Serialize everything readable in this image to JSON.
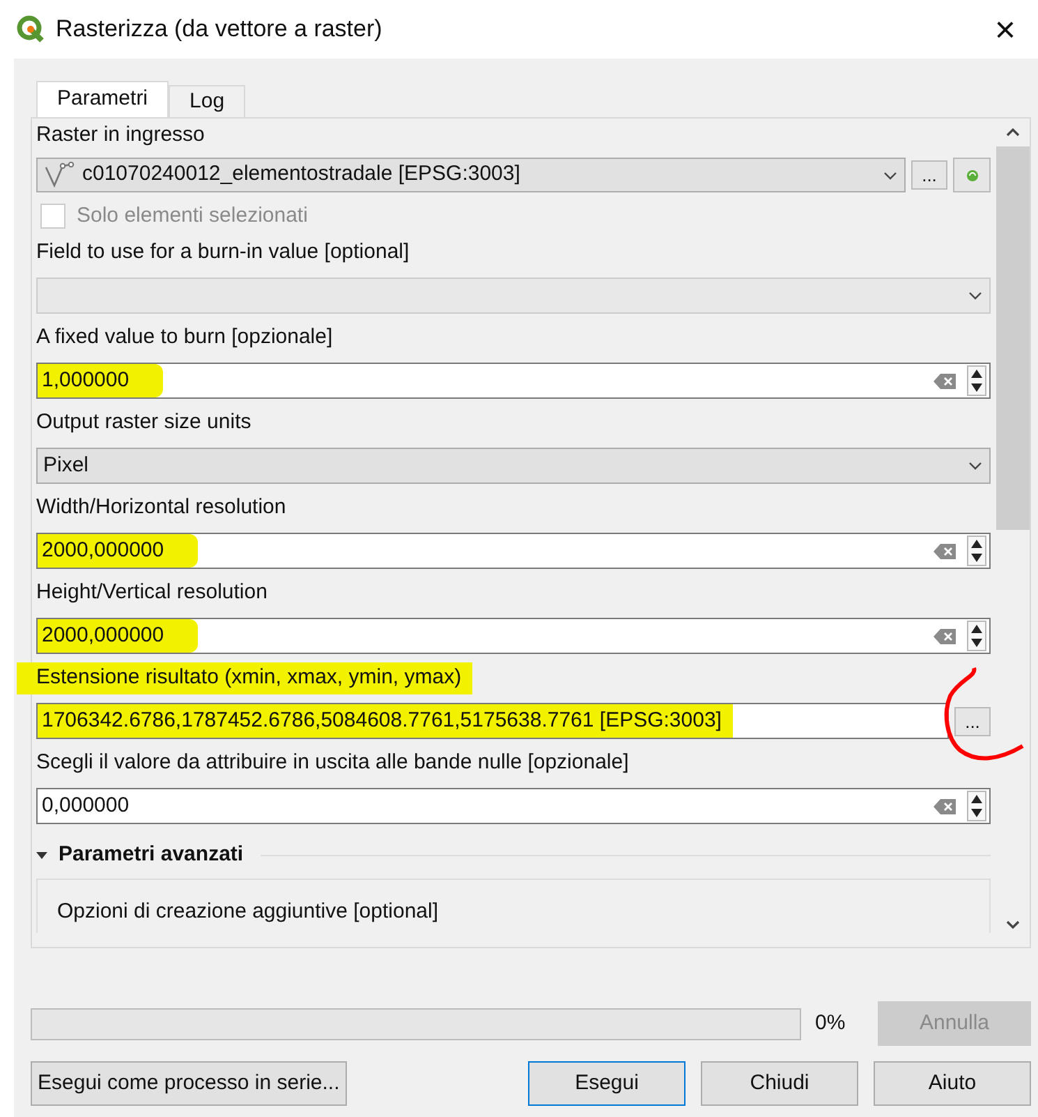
{
  "window": {
    "title": "Rasterizza (da vettore a raster)",
    "close": "×"
  },
  "tabs": [
    {
      "label": "Parametri",
      "selected": true
    },
    {
      "label": "Log",
      "selected": false
    }
  ],
  "params": [
    {
      "kind": "layer_combo",
      "label": "Raster in ingresso",
      "value": "c01070240012_elementostradale [EPSG:3003]",
      "button": "...",
      "checkbox": {
        "label": "Solo elementi selezionati",
        "checked": false,
        "disabled": true
      }
    },
    {
      "kind": "combo",
      "label": "Field to use for a burn-in value [optional]",
      "disabled": true
    },
    {
      "kind": "spin",
      "label": "A fixed value to burn [opzionale]",
      "value": "1,000000",
      "highlighted": true
    },
    {
      "kind": "combo",
      "label": "Output raster size units",
      "value": "Pixel",
      "disabled": false
    },
    {
      "kind": "spin",
      "label": "Width/Horizontal resolution",
      "value": "2000,000000",
      "highlighted": true
    },
    {
      "kind": "spin",
      "label": "Height/Vertical resolution",
      "value": "2000,000000",
      "highlighted": true
    },
    {
      "kind": "extent",
      "label": "Estensione risultato (xmin, xmax, ymin, ymax)",
      "value": "1706342.6786,1787452.6786,5084608.7761,5175638.7761 [EPSG:3003]",
      "button": "...",
      "highlighted": true,
      "circled": true
    },
    {
      "kind": "spin",
      "label": "Scegli il valore da attribuire in uscita alle bande nulle [opzionale]",
      "value": "0,000000",
      "highlighted": false
    },
    {
      "kind": "group",
      "label": "Parametri avanzati",
      "expanded": true,
      "children": [
        {
          "kind": "text",
          "label": "Opzioni di creazione aggiuntive [optional]"
        }
      ]
    }
  ],
  "progress": {
    "level": 0,
    "reading": "0%",
    "cancel": {
      "label": "Annulla",
      "disabled": true
    }
  },
  "buttons": [
    {
      "label": "Esegui come processo in serie...",
      "default": false
    },
    {
      "label": "Esegui",
      "default": true
    },
    {
      "label": "Chiudi",
      "default": false
    },
    {
      "label": "Aiuto",
      "default": false
    }
  ]
}
